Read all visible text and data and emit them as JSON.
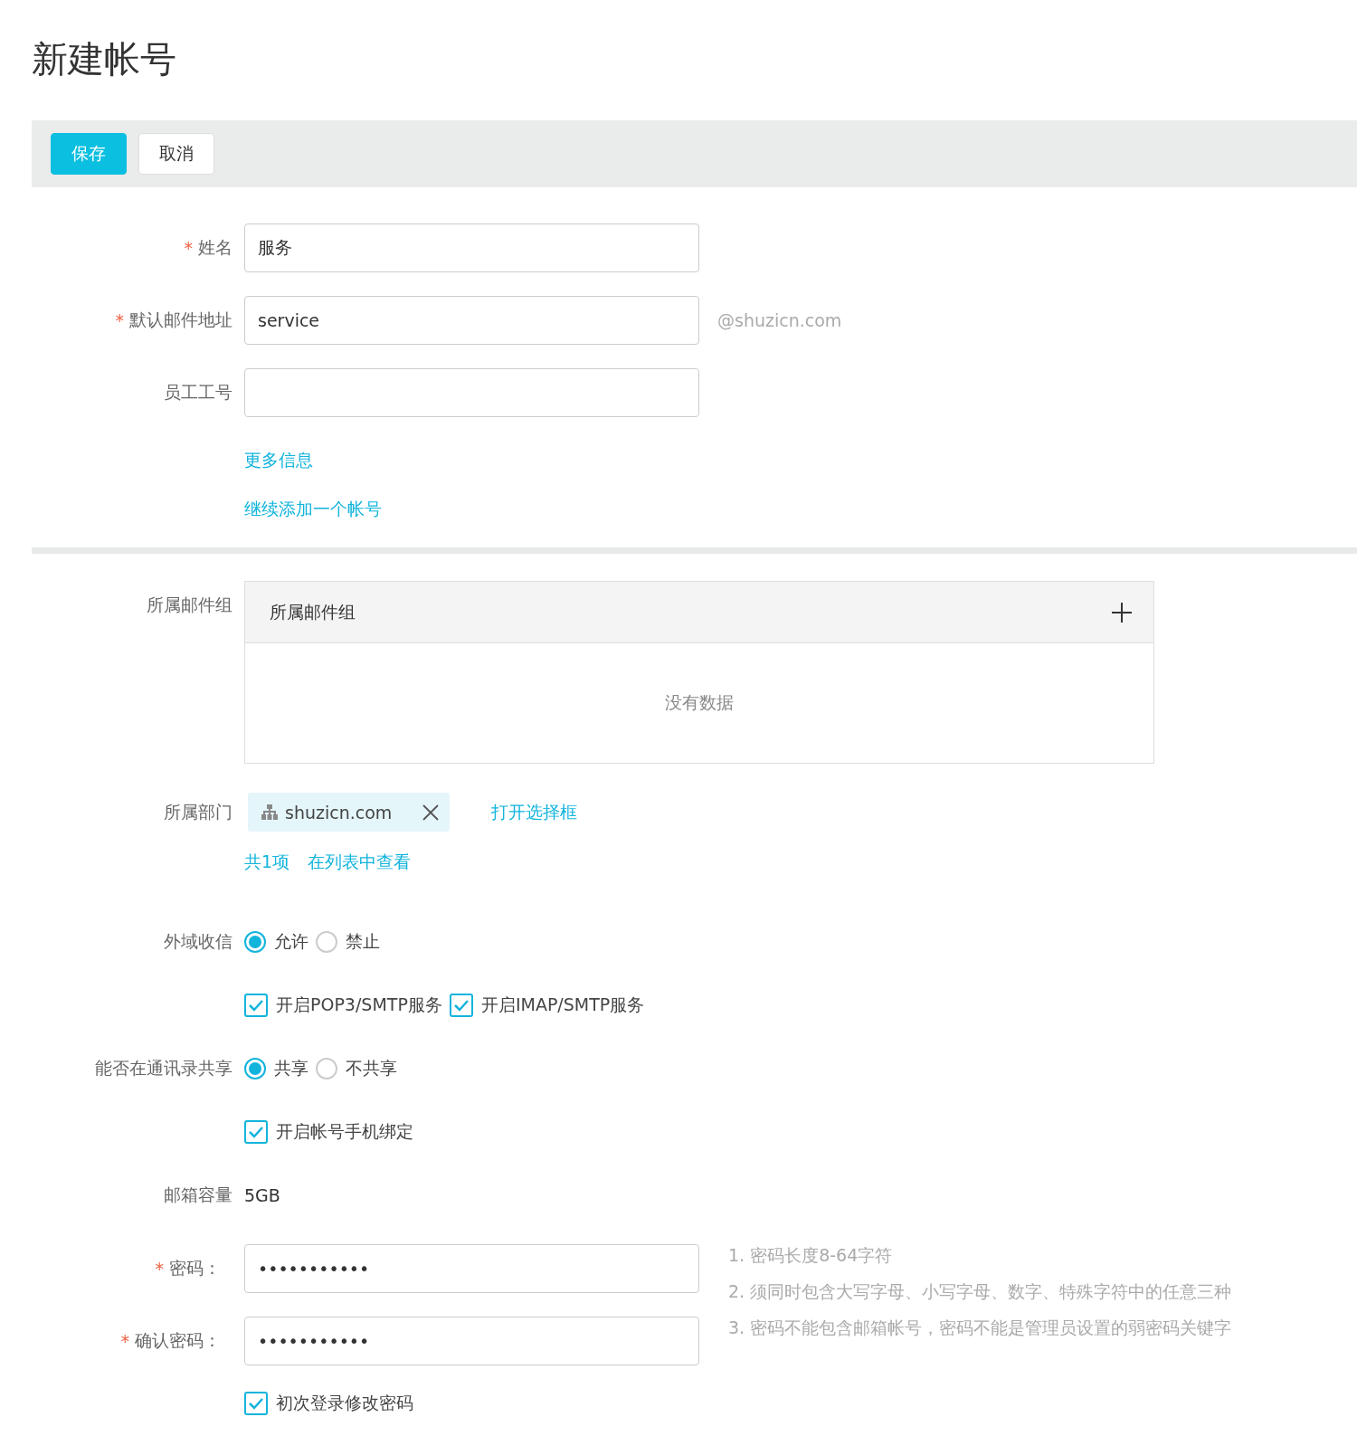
{
  "title": "新建帐号",
  "toolbar": [
    {
      "label": "保存",
      "kind": "primary"
    },
    {
      "label": "取消",
      "kind": "default"
    }
  ],
  "basic_fields": [
    {
      "marker": "*",
      "label": "姓名",
      "value": "服务"
    },
    {
      "marker": "*",
      "label": "默认邮件地址",
      "value": "service",
      "suffix": "@shuzicn.com"
    },
    {
      "label": "员工工号"
    }
  ],
  "links": [
    "更多信息",
    "继续添加一个帐号"
  ],
  "mail_groups": {
    "label": "所属邮件组",
    "header": "所属邮件组",
    "empty_text": "没有数据"
  },
  "department": {
    "label": "所属部门",
    "tag": "shuzicn.com",
    "open_link": "打开选择框",
    "count_link": "共1项",
    "view_link": "在列表中查看"
  },
  "options": [
    {
      "kind": "radio",
      "label": "外域收信",
      "choices": [
        {
          "label": "允许",
          "selected": true
        },
        {
          "label": "禁止",
          "selected": false
        }
      ]
    },
    {
      "kind": "checks",
      "choices": [
        {
          "label": "开启POP3/SMTP服务",
          "checked": true
        },
        {
          "label": "开启IMAP/SMTP服务",
          "checked": true
        }
      ]
    },
    {
      "kind": "radio",
      "label": "能否在通讯录共享",
      "choices": [
        {
          "label": "共享",
          "selected": true
        },
        {
          "label": "不共享",
          "selected": false
        }
      ]
    },
    {
      "kind": "checks",
      "choices": [
        {
          "label": "开启帐号手机绑定",
          "checked": true
        }
      ]
    },
    {
      "kind": "text",
      "label": "邮箱容量",
      "value": "5GB"
    }
  ],
  "password_fields": [
    {
      "marker": "*",
      "label": "密码：",
      "value": "•••••••••••"
    },
    {
      "marker": "*",
      "label": "确认密码：",
      "value": "•••••••••••"
    }
  ],
  "password_rules": [
    "1. 密码长度8-64字符",
    "2. 须同时包含大写字母、小写字母、数字、特殊字符中的任意三种",
    "3. 密码不能包含邮箱帐号，密码不能是管理员设置的弱密码关键字"
  ],
  "change_on_first_login": {
    "label": "初次登录修改密码",
    "checked": true
  }
}
